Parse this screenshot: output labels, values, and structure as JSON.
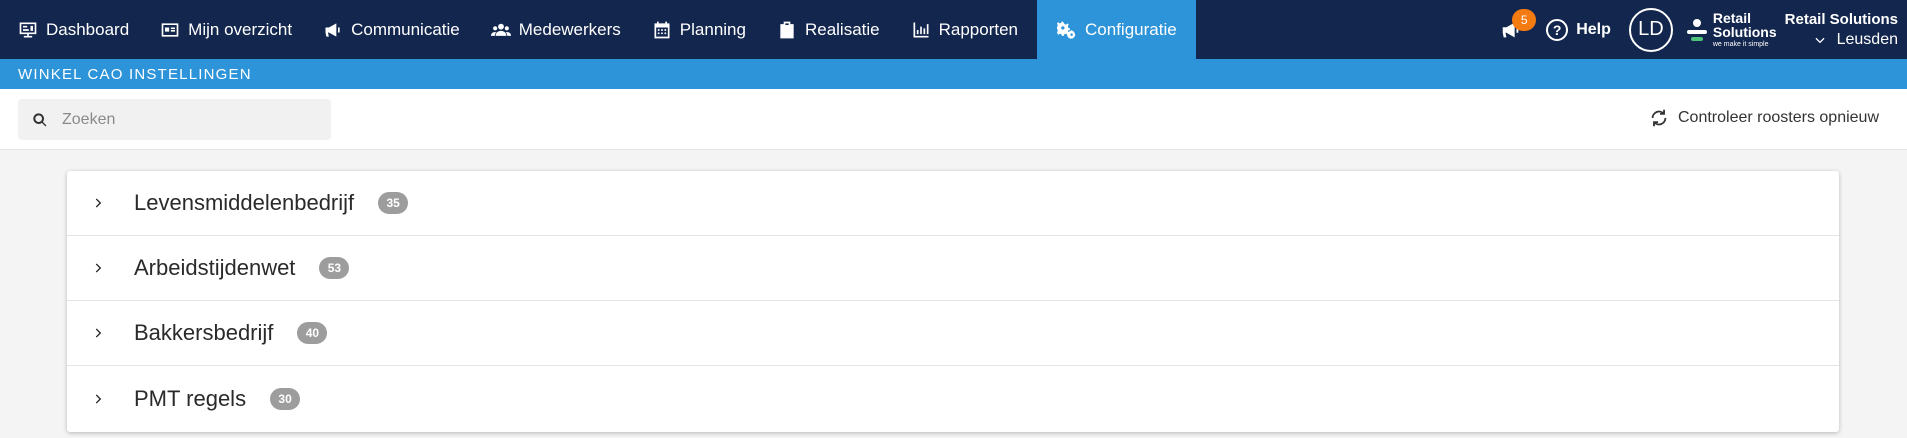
{
  "nav": {
    "items": [
      {
        "label": "Dashboard",
        "icon": "monitor-icon",
        "active": false
      },
      {
        "label": "Mijn overzicht",
        "icon": "id-card-icon",
        "active": false
      },
      {
        "label": "Communicatie",
        "icon": "megaphone-icon",
        "active": false
      },
      {
        "label": "Medewerkers",
        "icon": "users-icon",
        "active": false
      },
      {
        "label": "Planning",
        "icon": "calendar-icon",
        "active": false
      },
      {
        "label": "Realisatie",
        "icon": "clipboard-icon",
        "active": false
      },
      {
        "label": "Rapporten",
        "icon": "bar-chart-icon",
        "active": false
      },
      {
        "label": "Configuratie",
        "icon": "gears-icon",
        "active": true
      }
    ],
    "announcements_count": "5",
    "help_label": "Help",
    "avatar_initials": "LD",
    "brand": {
      "line1": "Retail",
      "line2": "Solutions",
      "tagline": "we make it simple"
    },
    "store": {
      "company": "Retail Solutions",
      "location": "Leusden"
    }
  },
  "section_title": "WINKEL CAO INSTELLINGEN",
  "toolbar": {
    "search_placeholder": "Zoeken",
    "search_value": "",
    "recheck_label": "Controleer roosters opnieuw"
  },
  "groups": [
    {
      "name": "Levensmiddelenbedrijf",
      "count": "35"
    },
    {
      "name": "Arbeidstijdenwet",
      "count": "53"
    },
    {
      "name": "Bakkersbedrijf",
      "count": "40"
    },
    {
      "name": "PMT regels",
      "count": "30"
    }
  ],
  "colors": {
    "topbar": "#13264d",
    "accent": "#2d94da",
    "badge": "#f47a12",
    "count_badge": "#9d9d9d"
  }
}
